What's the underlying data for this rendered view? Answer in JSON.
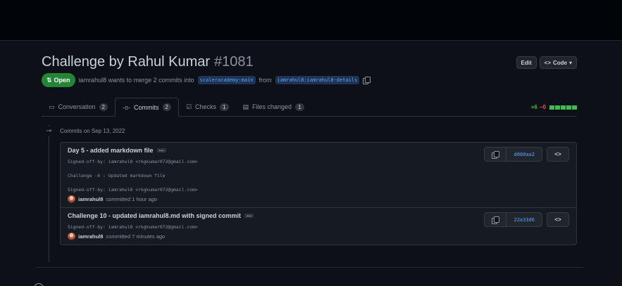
{
  "pr": {
    "title": "Challenge by Rahul Kumar",
    "number": "#1081",
    "state": "Open",
    "author": "iamrahul8",
    "merge_text": "wants to merge 2 commits into",
    "base_branch": "scaleracademy:main",
    "from_text": "from",
    "head_branch": "iamrahul8:iamrahul8-details"
  },
  "header_buttons": {
    "edit": "Edit",
    "code": "Code"
  },
  "tabs": [
    {
      "label": "Conversation",
      "count": "2",
      "icon": "comment-icon"
    },
    {
      "label": "Commits",
      "count": "2",
      "icon": "commit-icon"
    },
    {
      "label": "Checks",
      "count": "1",
      "icon": "checklist-icon"
    },
    {
      "label": "Files changed",
      "count": "1",
      "icon": "file-diff-icon"
    }
  ],
  "diffstat": {
    "additions": "+6",
    "deletions": "−0"
  },
  "commits_group": {
    "date_label": "Commits on Sep 13, 2022"
  },
  "commits": [
    {
      "title": "Day 5 - added markdown file",
      "ellipsis": "…",
      "body_line1": "Signed-off-by: iamrahul8 <rkgkumar072@gmail.com>",
      "body_line2": "Challenge -6 : Updated markdown file",
      "body_line3": "Signed-off-by: iamrahul8 <rkgkumar072@gmail.com>",
      "author": "iamrahul8",
      "time": "committed 1 hour ago",
      "sha": "d000aa2",
      "browse": "<>"
    },
    {
      "title": "Challenge 10 - updated iamrahul8.md with signed commit",
      "ellipsis": "…",
      "body_line1": "Signed-off-by: iamrahul8 <rkgkumar072@gmail.com>",
      "author": "iamrahul8",
      "time": "committed 7 minutes ago",
      "sha": "22a33d6",
      "browse": "<>"
    }
  ],
  "colors": {
    "background": "#0d1117",
    "open_green": "#238636",
    "link_blue": "#58a6ff",
    "add_green": "#3fb950",
    "del_red": "#f85149"
  }
}
